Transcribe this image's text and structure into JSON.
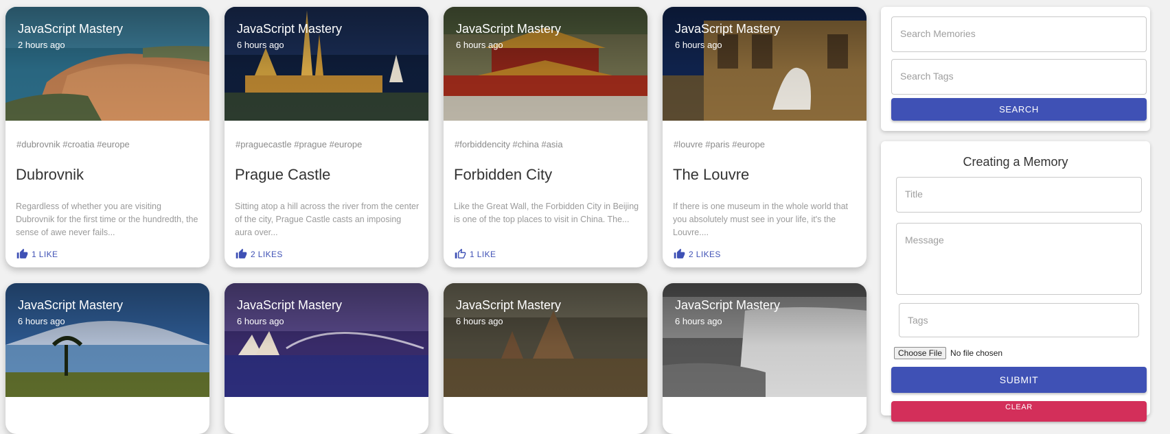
{
  "colors": {
    "primary": "#3f51b5",
    "secondary": "#d32f5a",
    "background": "#f1f1f1"
  },
  "posts": [
    {
      "author": "JavaScript Mastery",
      "time": "2 hours ago",
      "tags": "#dubrovnik #croatia #europe",
      "title": "Dubrovnik",
      "message": "Regardless of whether you are visiting Dubrovnik for the first time or the hundredth, the sense of awe never fails...",
      "likes": "1 LIKE",
      "liked": true,
      "image": "coastal-city-photo"
    },
    {
      "author": "JavaScript Mastery",
      "time": "6 hours ago",
      "tags": "#praguecastle #prague #europe",
      "title": "Prague Castle",
      "message": "Sitting atop a hill across the river from the center of the city, Prague Castle casts an imposing aura over...",
      "likes": "2 LIKES",
      "liked": true,
      "image": "castle-night-photo"
    },
    {
      "author": "JavaScript Mastery",
      "time": "6 hours ago",
      "tags": "#forbiddencity #china #asia",
      "title": "Forbidden City",
      "message": "Like the Great Wall, the Forbidden City in Beijing is one of the top places to visit in China. The...",
      "likes": "1 LIKE",
      "liked": false,
      "image": "palace-photo"
    },
    {
      "author": "JavaScript Mastery",
      "time": "6 hours ago",
      "tags": "#louvre #paris #europe",
      "title": "The Louvre",
      "message": "If there is one museum in the whole world that you absolutely must see in your life, it's the Louvre....",
      "likes": "2 LIKES",
      "liked": true,
      "image": "museum-statue-photo"
    },
    {
      "author": "JavaScript Mastery",
      "time": "6 hours ago",
      "image": "mountain-savanna-photo"
    },
    {
      "author": "JavaScript Mastery",
      "time": "6 hours ago",
      "image": "harbour-bridge-photo"
    },
    {
      "author": "JavaScript Mastery",
      "time": "6 hours ago",
      "image": "temples-photo"
    },
    {
      "author": "JavaScript Mastery",
      "time": "6 hours ago",
      "image": "waterfall-photo"
    }
  ],
  "search": {
    "memories_placeholder": "Search Memories",
    "tags_placeholder": "Search Tags",
    "button_label": "SEARCH"
  },
  "form": {
    "heading": "Creating a Memory",
    "title_placeholder": "Title",
    "message_placeholder": "Message",
    "tags_placeholder": "Tags",
    "file_button": "Choose File",
    "file_status": "No file chosen",
    "submit_label": "SUBMIT",
    "clear_label": "CLEAR"
  }
}
